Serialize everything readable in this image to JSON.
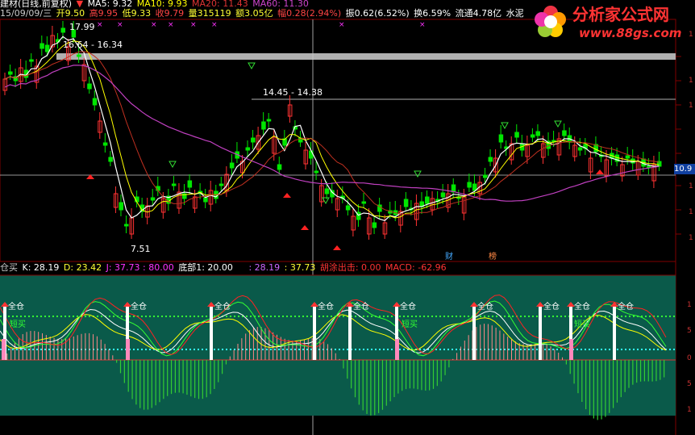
{
  "header": {
    "title": "建材(日线,前复权)",
    "ma5": "MA5: 9.32",
    "ma10": "MA10: 9.93",
    "ma20": "MA20: 11.43",
    "ma60": "MA60: 11.30",
    "date": "15/09/09/三",
    "open": "开9.50",
    "high": "高9.95",
    "low": "低9.33",
    "close": "收9.79",
    "volume": "量315119",
    "amount": "额3.05亿",
    "change": "幅0.28(2.94%)",
    "swing": "振0.62(6.52%)",
    "turnover": "换6.59%",
    "float": "流通4.78亿",
    "sector": "水泥"
  },
  "logo": {
    "name": "分析家公式网",
    "url": "www.88gs.com"
  },
  "price_labels": {
    "high_mark": "17.99",
    "range1": "16.64 - 16.34",
    "range2": "14.45 - 14.38",
    "low_mark": "7.51",
    "current_price": "10.9"
  },
  "event_tags": {
    "finance": "财",
    "rank": "榜"
  },
  "indicator": {
    "name": "仓买",
    "k": "K: 28.19",
    "d": "D: 23.42",
    "j": "J: 37.73 : 80.00",
    "bottom": "底部1: 20.00",
    "v1": ": 28.19",
    "v2": ": 37.73",
    "hudie": "胡涂出击: 0.00",
    "macd": "MACD: -62.96",
    "signal_full": "全仓",
    "signal_short": "短买"
  },
  "right_axis": {
    "labels": [
      "1",
      "1",
      "1",
      "1",
      "1",
      "1"
    ],
    "sub_labels": [
      "1",
      "1",
      "5",
      "0",
      "5",
      "1"
    ]
  },
  "colors": {
    "up": "#ff3232",
    "down": "#00e600",
    "ma5": "#ffffff",
    "ma10": "#ffff00",
    "ma20": "#c03020",
    "ma60": "#c040c0",
    "teal": "#0a5a4a"
  }
}
